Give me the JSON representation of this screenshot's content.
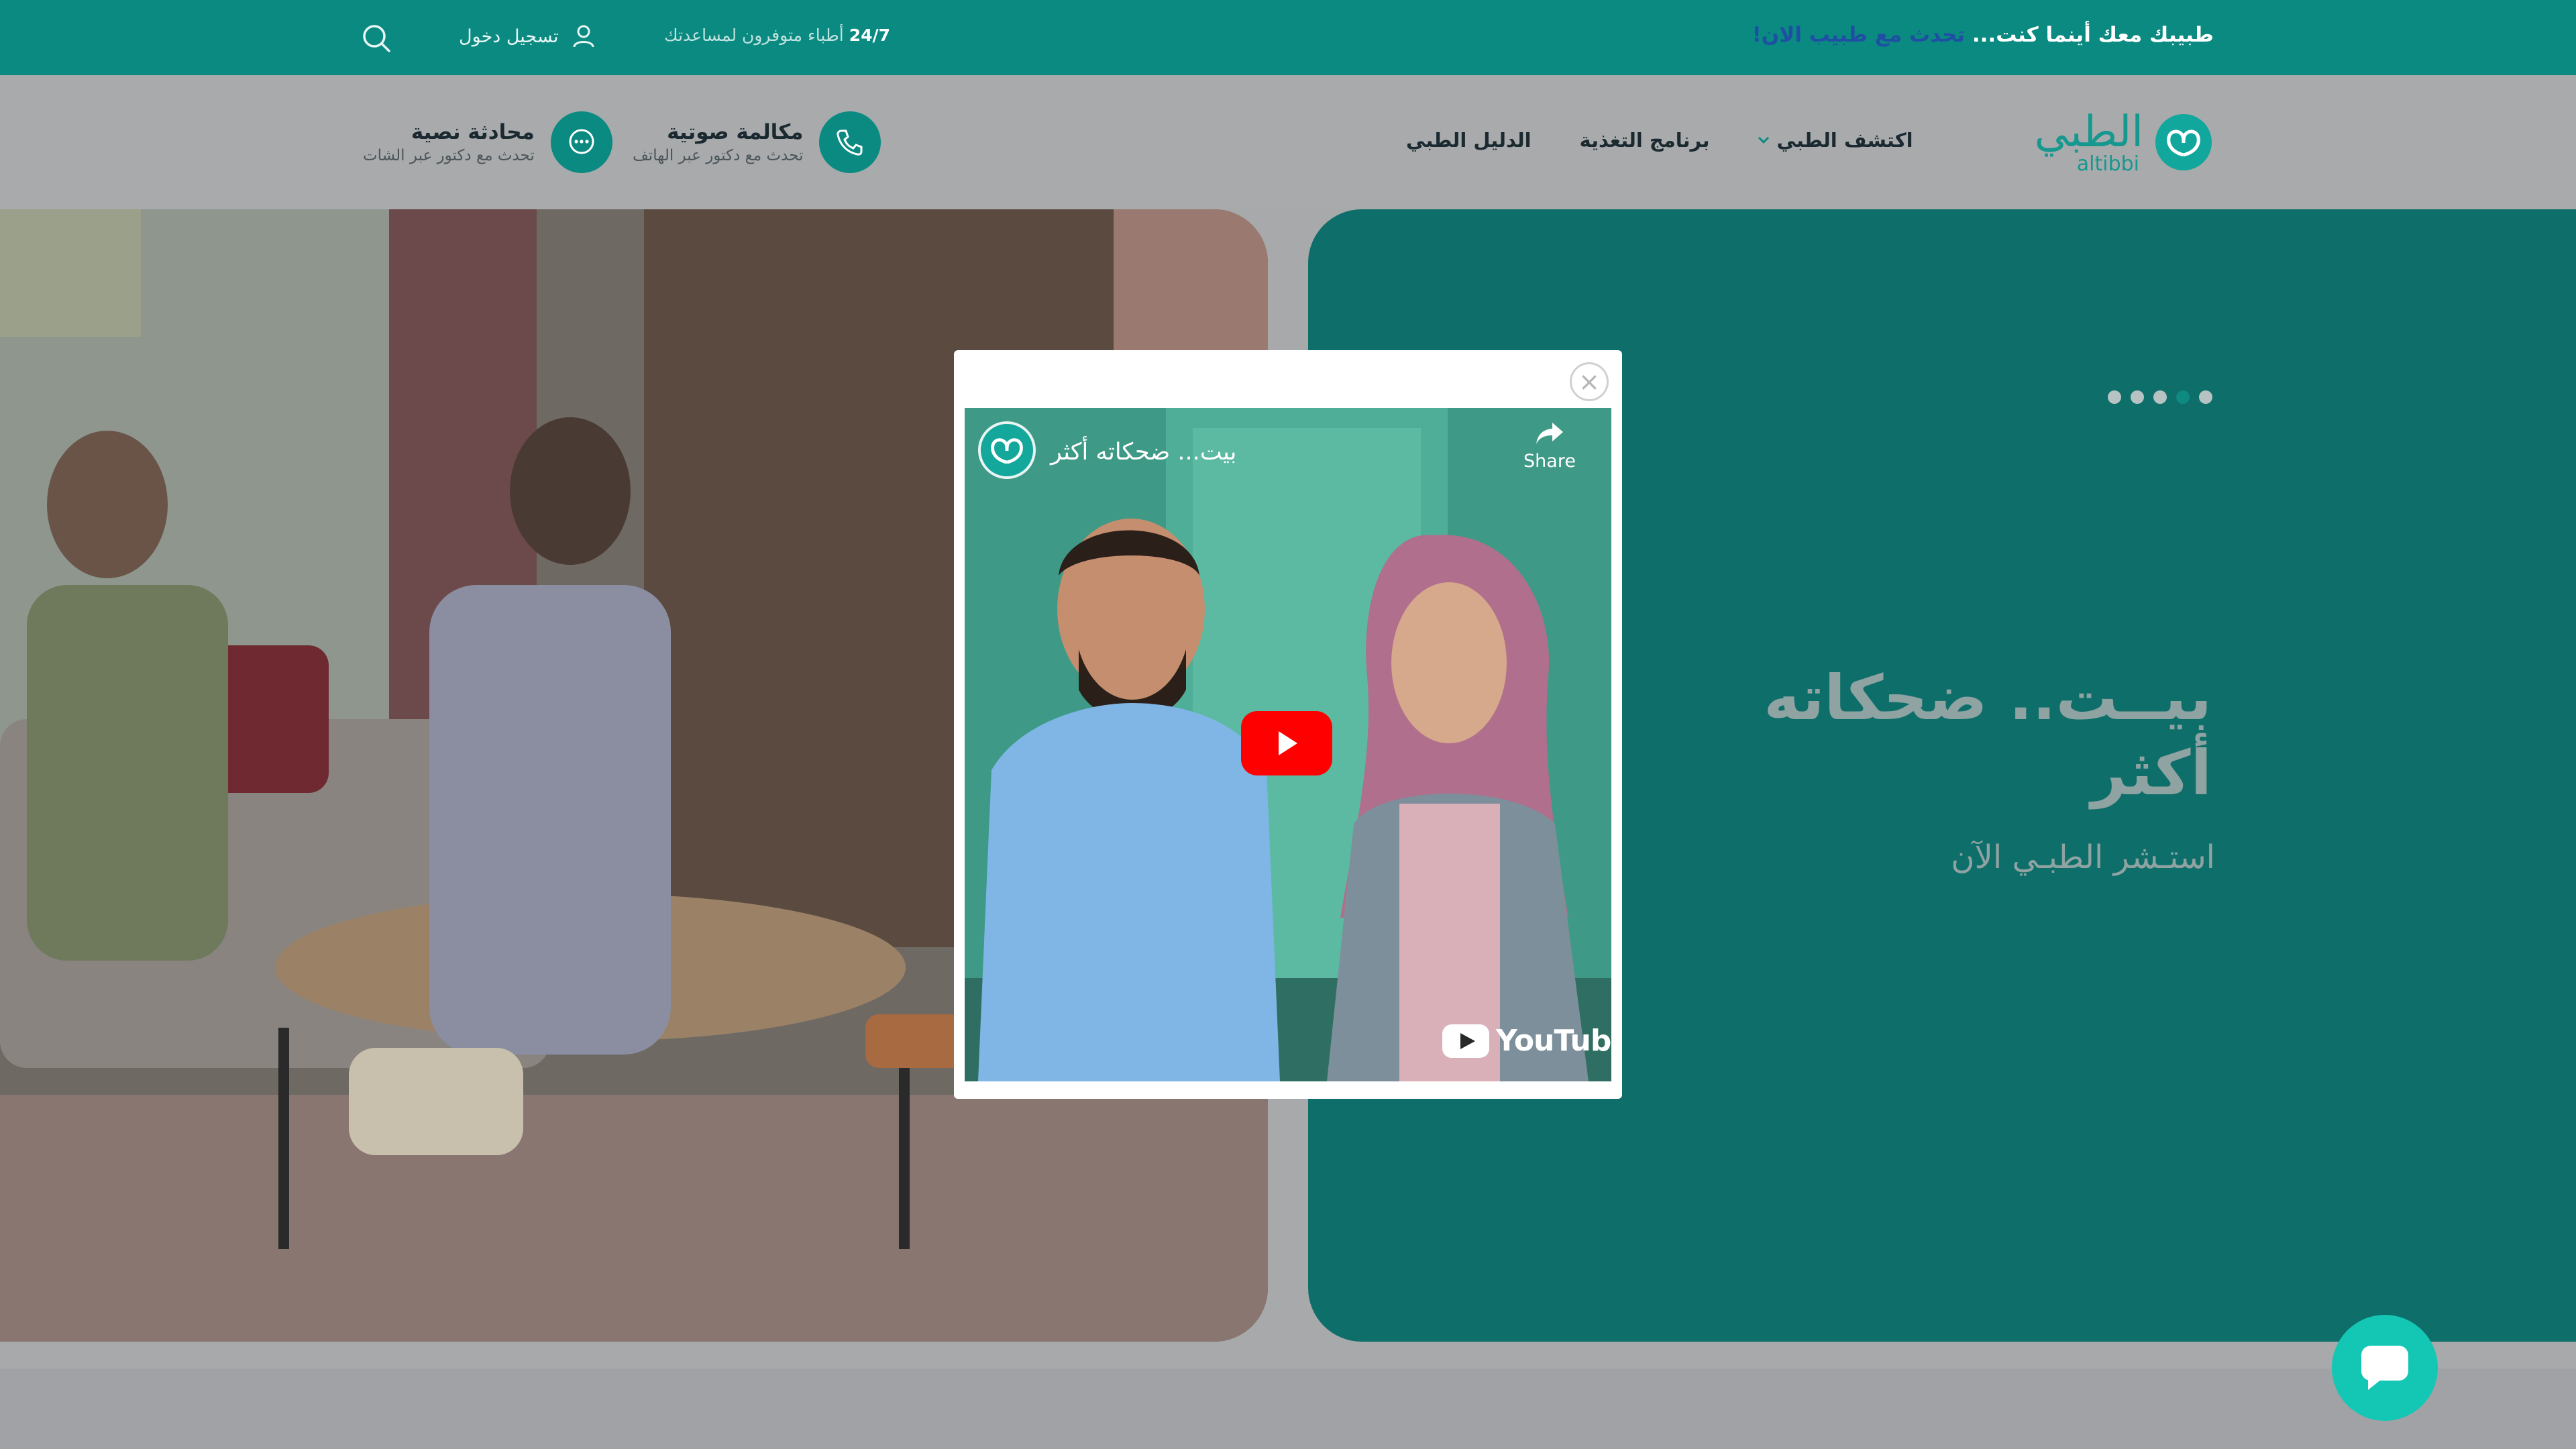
{
  "colors": {
    "brand": "#0b8a82",
    "overlay_dim": "#a7a9ab",
    "promo_link": "#1f4fa3",
    "youtube_red": "#ff0000",
    "chat_button": "#13c7b4"
  },
  "topbar": {
    "promo_text": "طبيبك معك أينما كنت...",
    "promo_link": "تحدث مع طبيب الان!",
    "availability_hours": "24/7",
    "availability_text": "أطباء متوفرون لمساعدتك",
    "login_label": "تسجيل دخول",
    "login_icon": "user-icon",
    "search_icon": "search-icon"
  },
  "navbar": {
    "logo_ar": "الطبي",
    "logo_en": "altibbi",
    "links": [
      {
        "label": "اكتشف الطبي",
        "dropdown": true
      },
      {
        "label": "برنامج التغذية",
        "dropdown": false
      },
      {
        "label": "الدليل الطبي",
        "dropdown": false
      }
    ],
    "voice_call": {
      "title": "مكالمة صوتية",
      "subtitle": "تحدث مع دكتور عبر الهاتف",
      "icon": "phone-icon"
    },
    "text_chat": {
      "title": "محادثة نصية",
      "subtitle": "تحدث مع دكتور عبر الشات",
      "icon": "chat-bubble-icon"
    }
  },
  "hero": {
    "title": "بيــت.. ضحكاته أكثر",
    "subtitle": "استـشر الطبـي الآن",
    "slide_count": 5,
    "active_slide": 2
  },
  "modal": {
    "close_symbol": "×",
    "video_title": "بيت... ضحكاته أكثر",
    "share_label": "Share",
    "youtube_label": "YouTube"
  },
  "chat_widget": {
    "icon": "chat-icon"
  }
}
